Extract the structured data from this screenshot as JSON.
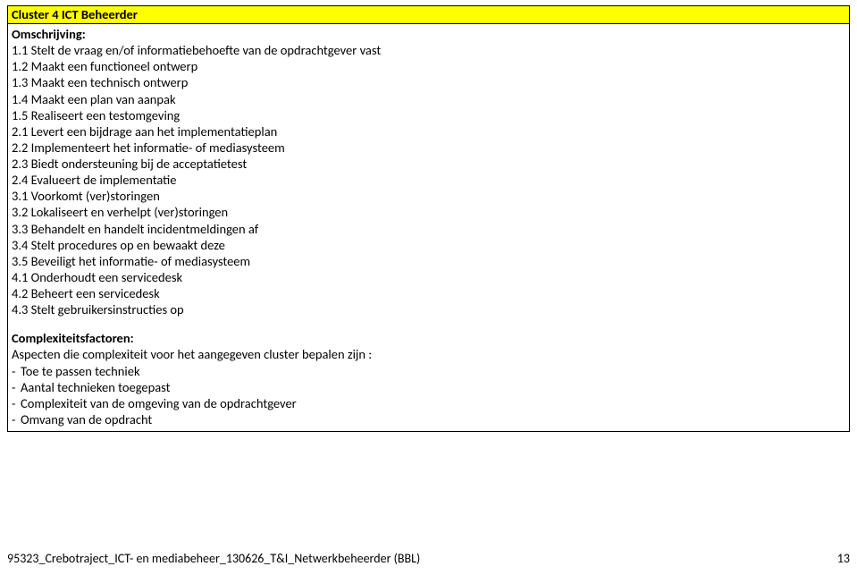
{
  "header": {
    "title": "Cluster 4 ICT Beheerder"
  },
  "sections": {
    "omschrijving_label": "Omschrijving:",
    "omschrijving_items": [
      "1.1 Stelt de vraag en/of informatiebehoefte van de opdrachtgever vast",
      "1.2 Maakt een functioneel ontwerp",
      "1.3 Maakt een technisch ontwerp",
      "1.4 Maakt een plan van aanpak",
      "1.5 Realiseert een testomgeving",
      "2.1 Levert een bijdrage aan het implementatieplan",
      "2.2 Implementeert het informatie- of mediasysteem",
      "2.3 Biedt ondersteuning bij de acceptatietest",
      "2.4 Evalueert de implementatie",
      "3.1 Voorkomt (ver)storingen",
      "3.2 Lokaliseert en verhelpt (ver)storingen",
      "3.3 Behandelt en handelt incidentmeldingen af",
      "3.4 Stelt procedures op en bewaakt deze",
      "3.5 Beveiligt het informatie- of mediasysteem",
      "4.1 Onderhoudt een servicedesk",
      "4.2 Beheert een servicedesk",
      "4.3 Stelt gebruikersinstructies op"
    ],
    "complexiteit_label": "Complexiteitsfactoren:",
    "complexiteit_intro": "Aspecten die complexiteit voor het aangegeven cluster bepalen zijn :",
    "complexiteit_items": [
      "Toe te passen techniek",
      "Aantal technieken toegepast",
      "Complexiteit van de omgeving van de opdrachtgever",
      "Omvang van de opdracht"
    ]
  },
  "footer": {
    "filename": "95323_Crebotraject_ICT- en mediabeheer_130626_T&I_Netwerkbeheerder (BBL)",
    "page": "13"
  }
}
